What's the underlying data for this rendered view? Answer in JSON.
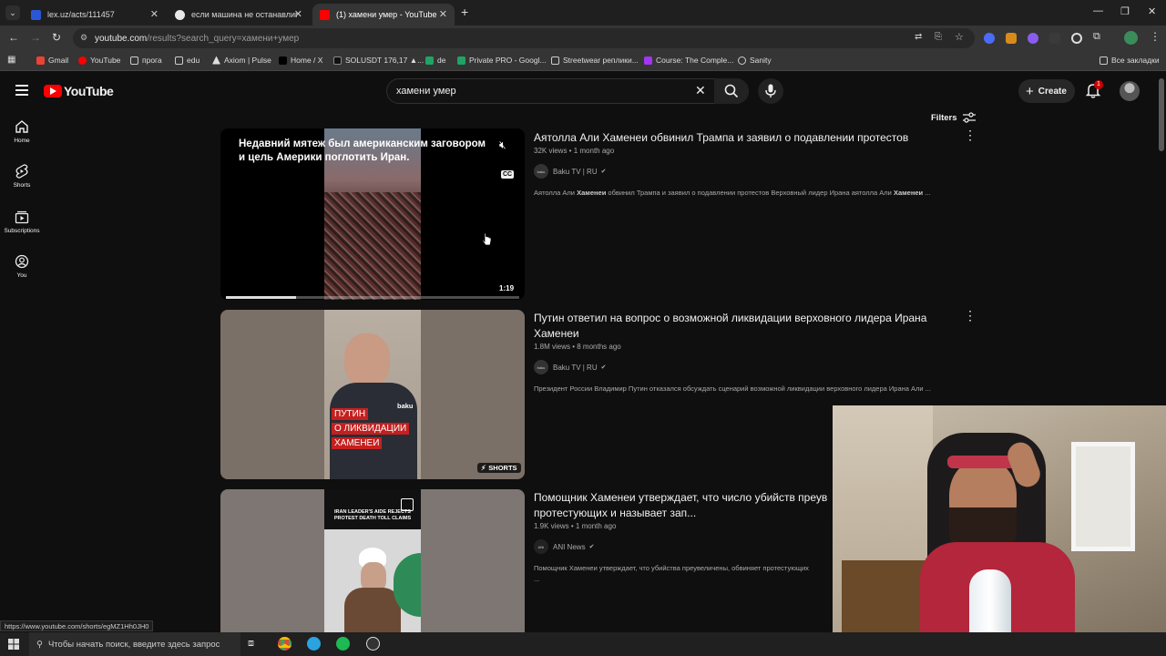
{
  "tabs": [
    {
      "title": "lex.uz/acts/111457",
      "fav_color": "#2b57d6"
    },
    {
      "title": "если машина не останавлива",
      "fav_color": "#e8e8e8"
    },
    {
      "title": "(1) хамени умер - YouTube",
      "fav_color": "#ff0000"
    }
  ],
  "address": {
    "host": "youtube.com",
    "path": "/results?search_query=хамени+умер"
  },
  "bookmarks": [
    "Gmail",
    "YouTube",
    "прога",
    "edu",
    "Axiom | Pulse",
    "Home / X",
    "SOLUSDT 176,17 ▲...",
    "de",
    "Private PRO - Googl...",
    "Streetwear реплики...",
    "Course: The Comple...",
    "Sanity"
  ],
  "all_bookmarks": "Все закладки",
  "yt": {
    "logo": "YouTube",
    "search_value": "хамени умер",
    "create_label": "Create",
    "notif_count": "1",
    "filters_label": "Filters"
  },
  "sidebar": [
    {
      "label": "Home",
      "icon": "home-icon"
    },
    {
      "label": "Shorts",
      "icon": "shorts-icon"
    },
    {
      "label": "Subscriptions",
      "icon": "subscriptions-icon"
    },
    {
      "label": "You",
      "icon": "you-icon"
    }
  ],
  "results": [
    {
      "title": "Аятолла Али Хаменеи обвинил Трампа и заявил о подавлении протестов",
      "meta": "32K views • 1 month ago",
      "channel": "Baku TV | RU",
      "desc_pre": "Аятолла Али ",
      "desc_b1": "Хаменеи",
      "desc_mid": " обвинил Трампа и заявил о подавлении протестов Верховный лидер Ирана аятолла Али ",
      "desc_b2": "Хаменеи",
      "desc_post": " ...",
      "overlay_text": "Недавний мятеж был американским заговором и цель Америки поглотить Иран.",
      "duration": "1:19",
      "cc": "CC"
    },
    {
      "title": "Путин ответил на вопрос о возможной ликвидации верховного лидера Ирана Хаменеи",
      "meta": "1.8M views • 8 months ago",
      "channel": "Baku TV | RU",
      "desc": "Президент России Владимир Путин отказался обсуждать сценарий возможной ликвидации верховного лидера Ирана Али ...",
      "thumb_lines": [
        "ПУТИН",
        "О ЛИКВИДАЦИИ",
        "ХАМЕНЕИ"
      ],
      "thumb_brand": "baku",
      "badge": "SHORTS"
    },
    {
      "title": "Помощник Хаменеи утверждает, что число убийств преув протестующих и называет зап...",
      "title_line1": "Помощник Хаменеи утверждает, что число убийств преув",
      "title_line2": "протестующих и называет зап...",
      "meta": "1.9K views • 1 month ago",
      "channel": "ANI News",
      "desc": "Помощник Хаменеи утверждает, что убийства преувеличены, обвиняет протестующих",
      "desc2": "...",
      "thumb_caption": "IRAN LEADER'S AIDE REJECTS PROTEST DEATH TOLL CLAIMS"
    }
  ],
  "status_url": "https://www.youtube.com/shorts/egMZ1Hh0JH0",
  "taskbar": {
    "search_placeholder": "Чтобы начать поиск, введите здесь запрос"
  }
}
